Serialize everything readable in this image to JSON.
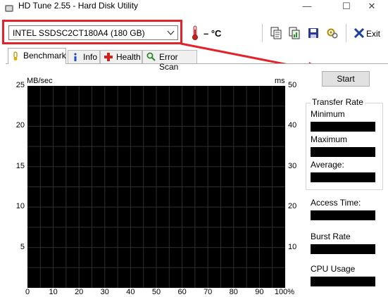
{
  "window": {
    "title": "HD Tune 2.55 - Hard Disk Utility",
    "controls": {
      "minimize": "—",
      "maximize": "☐",
      "close": "✕"
    }
  },
  "toolbar": {
    "drive": "INTEL SSDSC2CT180A4 (180 GB)",
    "temperature": "– °C",
    "exit_label": "Exit",
    "icons": [
      "copy-text-icon",
      "copy-image-icon",
      "save-icon",
      "options-icon",
      "exit-icon"
    ]
  },
  "tabs": [
    {
      "label": "Benchmark",
      "icon": "benchmark-icon",
      "active": true
    },
    {
      "label": "Info",
      "icon": "info-icon",
      "active": false
    },
    {
      "label": "Health",
      "icon": "health-icon",
      "active": false
    },
    {
      "label": "Error Scan",
      "icon": "error-scan-icon",
      "active": false
    }
  ],
  "chart": {
    "left_unit": "MB/sec",
    "right_unit": "ms",
    "left_ticks": [
      "25",
      "20",
      "15",
      "10",
      "5"
    ],
    "right_ticks": [
      "50",
      "40",
      "30",
      "20",
      "10"
    ],
    "x_ticks": [
      "0",
      "10",
      "20",
      "30",
      "40",
      "50",
      "60",
      "70",
      "80",
      "90",
      "100%"
    ]
  },
  "side_panel": {
    "start_label": "Start",
    "transfer_rate_title": "Transfer Rate",
    "minimum_label": "Minimum",
    "maximum_label": "Maximum",
    "average_label": "Average:",
    "access_time_label": "Access Time:",
    "burst_rate_label": "Burst Rate",
    "cpu_usage_label": "CPU Usage"
  },
  "colors": {
    "annotation": "#e2232a",
    "plot_background": "#000000",
    "grid": "#2e2e2e"
  }
}
